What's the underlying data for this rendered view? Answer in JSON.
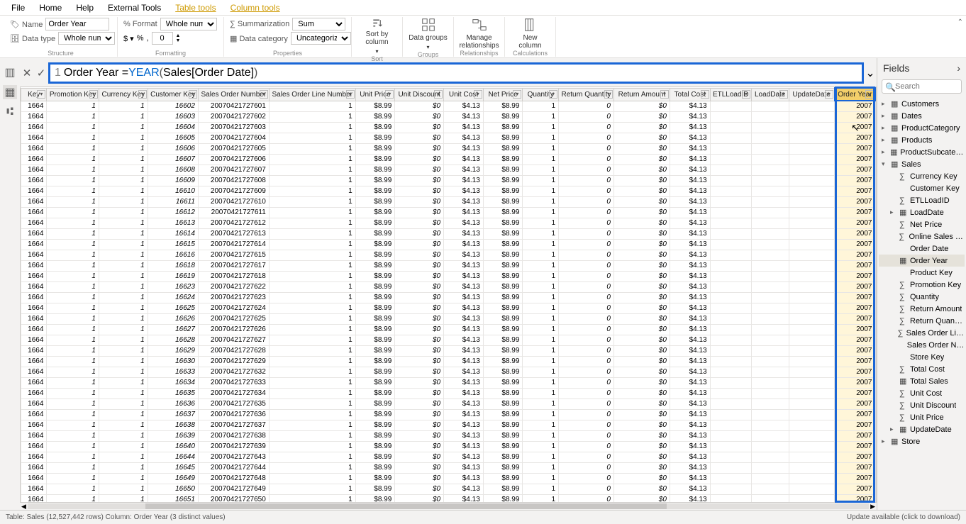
{
  "menu": {
    "items": [
      "File",
      "Home",
      "Help",
      "External Tools",
      "Table tools",
      "Column tools"
    ],
    "activeIndex": 5
  },
  "ribbon": {
    "name_label": "Name",
    "name_value": "Order Year",
    "datatype_label": "Data type",
    "datatype_value": "Whole number",
    "format_label": "Format",
    "format_value": "Whole number",
    "decimals_value": "0",
    "summ_label": "Summarization",
    "summ_value": "Sum",
    "cat_label": "Data category",
    "cat_value": "Uncategorized",
    "groups": {
      "structure": "Structure",
      "formatting": "Formatting",
      "properties": "Properties",
      "sort": "Sort",
      "groups": "Groups",
      "rel": "Relationships",
      "calc": "Calculations"
    },
    "big": {
      "sort": "Sort by column",
      "data_groups": "Data groups",
      "manage": "Manage relationships",
      "newcol": "New column"
    }
  },
  "formula": {
    "line": "1",
    "text_plain": "Order Year = YEAR ( Sales[Order Date] )",
    "pre": "Order Year = ",
    "fn": "YEAR",
    "mid": " ( ",
    "arg": "Sales[Order Date]",
    "post": " )"
  },
  "columns": [
    "Key",
    "Promotion Key",
    "Currency Key",
    "Customer Key",
    "Sales Order Number",
    "Sales Order Line Number",
    "Unit Price",
    "Unit Discount",
    "Unit Cost",
    "Net Price",
    "Quantity",
    "Return Quantity",
    "Return Amount",
    "Total Cost",
    "ETLLoadID",
    "LoadDate",
    "UpdateDate",
    "Order Year"
  ],
  "col_align": [
    "r",
    "i",
    "i",
    "i",
    "r",
    "r",
    "r",
    "i",
    "r",
    "r",
    "r",
    "i",
    "i",
    "r",
    "r",
    "",
    "",
    "",
    "hlcol"
  ],
  "row_template": {
    "key": "1664",
    "promo": "1",
    "curr": "1",
    "cust": "",
    "ckBase": 16602,
    "soBase": 200704217276,
    "soSuffixPad": 2,
    "soln": "1",
    "uprice": "$8.99",
    "udisc": "$0",
    "ucost": "$4.13",
    "nprice": "$8.99",
    "qty": "1",
    "rqty": "0",
    "ramt": "$0",
    "tcost": "$4.13",
    "etl": "",
    "ld": "",
    "ud": "",
    "oy": "2007"
  },
  "row_count": 38,
  "fields": {
    "title": "Fields",
    "search_ph": "Search",
    "tables": [
      {
        "name": "Customers",
        "open": false
      },
      {
        "name": "Dates",
        "open": false
      },
      {
        "name": "ProductCategory",
        "open": false
      },
      {
        "name": "Products",
        "open": false
      },
      {
        "name": "ProductSubcategory",
        "open": false
      },
      {
        "name": "Sales",
        "open": true,
        "cols": [
          {
            "n": "Currency Key",
            "t": "sum"
          },
          {
            "n": "Customer Key",
            "t": "field"
          },
          {
            "n": "ETLLoadID",
            "t": "sum"
          },
          {
            "n": "LoadDate",
            "t": "date",
            "exp": true
          },
          {
            "n": "Net Price",
            "t": "sum"
          },
          {
            "n": "Online Sales Key",
            "t": "sum"
          },
          {
            "n": "Order Date",
            "t": "field"
          },
          {
            "n": "Order Year",
            "t": "calc",
            "sel": true
          },
          {
            "n": "Product Key",
            "t": "field"
          },
          {
            "n": "Promotion Key",
            "t": "sum"
          },
          {
            "n": "Quantity",
            "t": "sum"
          },
          {
            "n": "Return Amount",
            "t": "sum"
          },
          {
            "n": "Return Quantity",
            "t": "sum"
          },
          {
            "n": "Sales Order Line Nu...",
            "t": "sum"
          },
          {
            "n": "Sales Order Number",
            "t": "field"
          },
          {
            "n": "Store Key",
            "t": "field"
          },
          {
            "n": "Total Cost",
            "t": "sum"
          },
          {
            "n": "Total Sales",
            "t": "calc"
          },
          {
            "n": "Unit Cost",
            "t": "sum"
          },
          {
            "n": "Unit Discount",
            "t": "sum"
          },
          {
            "n": "Unit Price",
            "t": "sum"
          },
          {
            "n": "UpdateDate",
            "t": "date",
            "exp": true
          }
        ]
      },
      {
        "name": "Store",
        "open": false
      }
    ]
  },
  "status": {
    "left": "Table: Sales (12,527,442 rows) Column: Order Year (3 distinct values)",
    "right": "Update available (click to download)"
  }
}
